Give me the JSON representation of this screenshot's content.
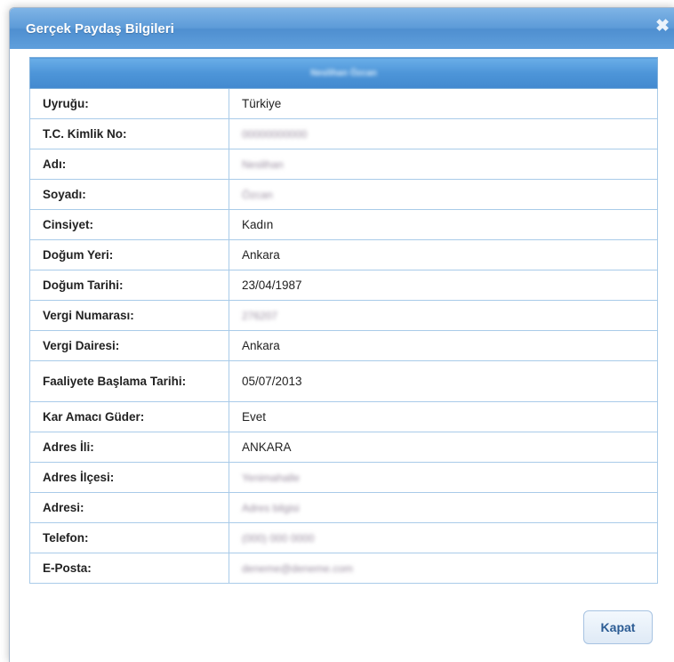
{
  "dialog": {
    "title": "Gerçek Paydaş Bilgileri",
    "close_glyph": "✖",
    "header": "Neslihan Özcan",
    "rows": [
      {
        "label": "Uyruğu:",
        "value": "Türkiye",
        "blurred": false
      },
      {
        "label": "T.C. Kimlik No:",
        "value": "00000000000",
        "blurred": true
      },
      {
        "label": "Adı:",
        "value": "Neslihan",
        "blurred": true
      },
      {
        "label": "Soyadı:",
        "value": "Özcan",
        "blurred": true
      },
      {
        "label": "Cinsiyet:",
        "value": "Kadın",
        "blurred": false
      },
      {
        "label": "Doğum Yeri:",
        "value": "Ankara",
        "blurred": false
      },
      {
        "label": "Doğum Tarihi:",
        "value": "23/04/1987",
        "blurred": false
      },
      {
        "label": "Vergi Numarası:",
        "value": "276207",
        "blurred": true
      },
      {
        "label": "Vergi Dairesi:",
        "value": "Ankara",
        "blurred": false
      },
      {
        "label": "Faaliyete Başlama Tarihi:",
        "value": "05/07/2013",
        "blurred": false
      },
      {
        "label": "Kar Amacı Güder:",
        "value": "Evet",
        "blurred": false
      },
      {
        "label": "Adres İli:",
        "value": "ANKARA",
        "blurred": false
      },
      {
        "label": "Adres İlçesi:",
        "value": "Yenimahalle",
        "blurred": true
      },
      {
        "label": "Adresi:",
        "value": "Adres bilgisi",
        "blurred": true
      },
      {
        "label": "Telefon:",
        "value": "(000) 000 0000",
        "blurred": true
      },
      {
        "label": "E-Posta:",
        "value": "deneme@deneme.com",
        "blurred": true
      }
    ],
    "close_button": "Kapat"
  }
}
